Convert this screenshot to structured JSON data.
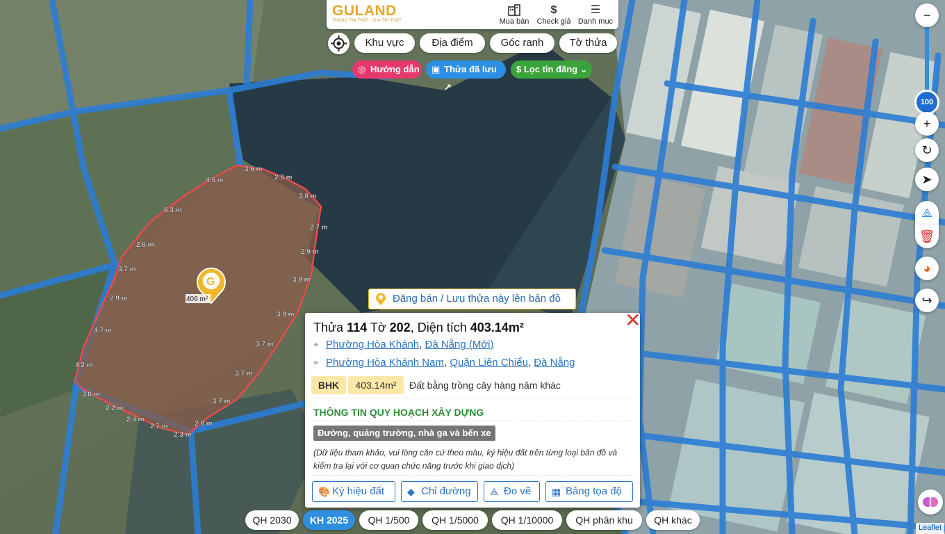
{
  "header": {
    "brand": "GULAND",
    "tagline": "THÔNG TIN THẬT - GIÁ TRỊ THẬT",
    "buttons": [
      {
        "label": "Mua bán",
        "icon": "building-icon"
      },
      {
        "label": "Check giá",
        "icon": "dollar-icon"
      },
      {
        "label": "Danh mục",
        "icon": "menu-icon"
      }
    ]
  },
  "filters": {
    "pills": [
      "Khu vực",
      "Địa điểm",
      "Góc ranh",
      "Tờ thửa"
    ],
    "chips": [
      {
        "label": "Hướng dẫn",
        "color": "#e6396b",
        "icon": "target-icon"
      },
      {
        "label": "Thửa đã lưu",
        "color": "#2d8fe6",
        "icon": "bookmark-icon"
      },
      {
        "label": "$ Lọc tin đăng",
        "color": "#3aa43a",
        "icon": "chevron-down-icon"
      }
    ]
  },
  "map": {
    "zoom_level": "100",
    "parcel_area_label": "406 m²",
    "edge_labels": [
      "3.6 m",
      "2.9 m",
      "3.8 m",
      "2.7 m",
      "2.9 m",
      "3.9 m",
      "3.9 m",
      "3.7 m",
      "3.7 m",
      "3.7 m",
      "2.8 m",
      "2.3 m",
      "2.7 m",
      "2.4 m",
      "2.2 m",
      "3.8 m",
      "4.2 m",
      "4.7 m",
      "2.9 m",
      "3.7 m",
      "2.6 m",
      "6.3 m",
      "4.5 m"
    ]
  },
  "cta": {
    "label": "Đăng bán / Lưu thửa này lên bản đồ"
  },
  "popup": {
    "title_prefix": "Thửa",
    "parcel_no": "114",
    "sheet_label": "Tờ",
    "sheet_no": "202",
    "area_label": ", Diện tích",
    "area": "403.14m²",
    "address_new": {
      "ward": "Phường Hòa Khánh",
      "city": "Đà Nẵng (Mới)"
    },
    "address_old": {
      "ward": "Phường Hòa Khánh Nam",
      "district": "Quận Liên Chiểu",
      "city": "Đà Nẵng"
    },
    "land_code": "BHK",
    "land_area": "403.14m²",
    "land_type": "Đất bằng trồng cây hàng năm khác",
    "section_title": "THÔNG TIN QUY HOẠCH XÂY DỰNG",
    "zone_tag": "Đường, quảng trường, nhà ga và bến xe",
    "note": "(Dữ liệu tham khảo, vui lòng căn cứ theo màu, ký hiệu đất trên từng loại bản đồ và kiểm tra lại với cơ quan chức năng trước khi giao dịch)",
    "actions": [
      "Ký hiệu đất",
      "Chỉ đường",
      "Đo vẽ",
      "Bảng tọa độ"
    ]
  },
  "bottom_tabs": [
    "QH 2030",
    "KH 2025",
    "QH 1/500",
    "QH 1/5000",
    "QH 1/10000",
    "QH phân khu",
    "QH khác"
  ],
  "active_tab": "KH 2025",
  "attribution": "Leaflet"
}
